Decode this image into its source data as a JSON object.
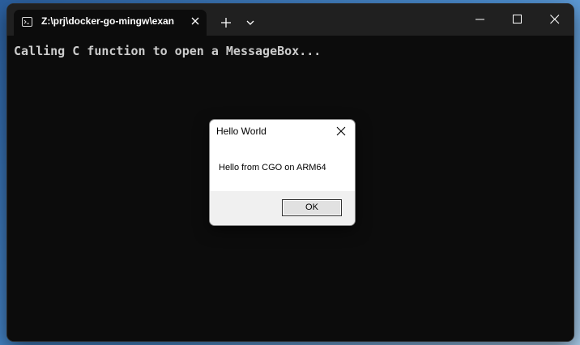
{
  "window": {
    "tab_title": "Z:\\prj\\docker-go-mingw\\exan",
    "tab_icon": "terminal-icon",
    "new_tab_icon": "plus-icon",
    "dropdown_icon": "chevron-down-icon",
    "controls": [
      "minimize-icon",
      "maximize-icon",
      "close-icon"
    ]
  },
  "console": {
    "output": "Calling C function to open a MessageBox..."
  },
  "dialog": {
    "title": "Hello World",
    "message": "Hello from CGO on ARM64",
    "ok_label": "OK"
  },
  "colors": {
    "console_bg": "#0c0c0c",
    "titlebar_bg": "#202020",
    "console_text": "#cccccc",
    "dialog_footer": "#f0f0f0"
  }
}
